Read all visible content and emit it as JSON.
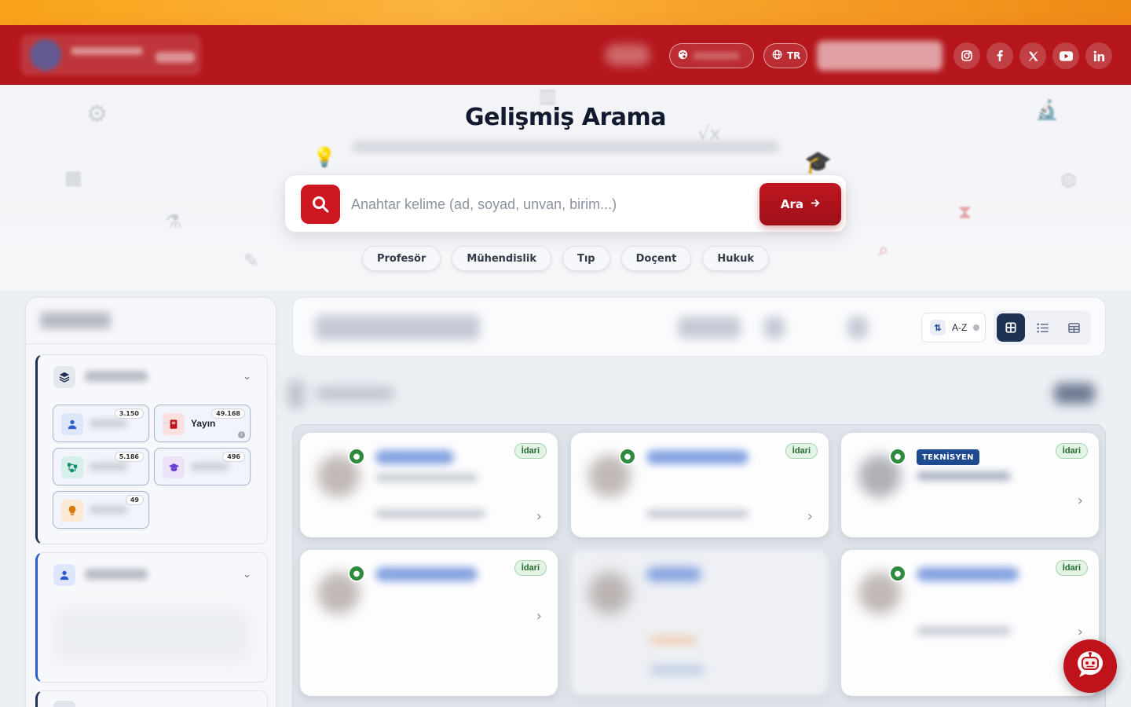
{
  "header": {
    "language_label": "TR",
    "socials": [
      "instagram-icon",
      "facebook-icon",
      "x-icon",
      "youtube-icon",
      "linkedin-icon"
    ],
    "brand_color": "#b4161c",
    "accent_strip_color": "#f9a31a"
  },
  "hero": {
    "title": "Gelişmiş Arama",
    "search_placeholder": "Anahtar kelime (ad, soyad, unvan, birim...)",
    "search_button": "Ara",
    "chips": [
      "Profesör",
      "Mühendislik",
      "Tıp",
      "Doçent",
      "Hukuk"
    ]
  },
  "sidebar": {
    "categories": [
      {
        "icon": "people-icon",
        "count": "3.150",
        "label": ""
      },
      {
        "icon": "book-icon",
        "count": "49.168",
        "label": "Yayın"
      },
      {
        "icon": "network-icon",
        "count": "5.186",
        "label": ""
      },
      {
        "icon": "graduation-cap-icon",
        "count": "496",
        "label": ""
      },
      {
        "icon": "lightbulb-icon",
        "count": "49",
        "label": ""
      }
    ]
  },
  "toolbar": {
    "sort_label": "A-Z",
    "views": [
      "grid-view-icon",
      "list-view-icon",
      "table-view-icon"
    ],
    "active_view": "grid-view-icon"
  },
  "results": {
    "cards": [
      {
        "tag": "İdari",
        "role": ""
      },
      {
        "tag": "İdari",
        "role": ""
      },
      {
        "tag": "İdari",
        "role": "TEKNİSYEN"
      },
      {
        "tag": "İdari",
        "role": ""
      },
      {
        "tag": "",
        "role": ""
      },
      {
        "tag": "İdari",
        "role": ""
      }
    ]
  }
}
